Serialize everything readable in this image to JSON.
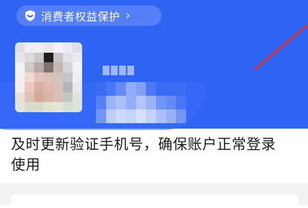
{
  "header": {
    "protection_label": "消费者权益保护",
    "chevron": "›",
    "shield_icon": "shield-check-icon",
    "accent_color": "#2f63f4"
  },
  "notice": {
    "line1": "及时更新验证手机号，确保账户正常登录",
    "line2": "使用"
  }
}
